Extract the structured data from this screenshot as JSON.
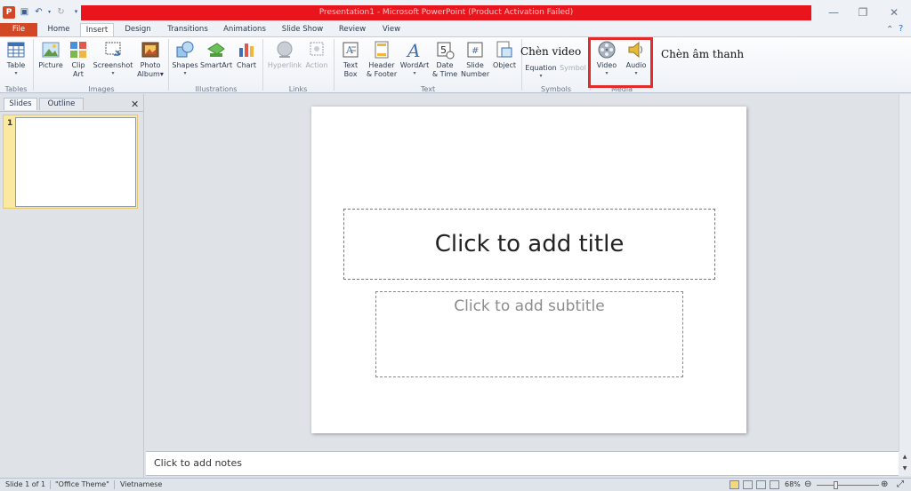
{
  "window": {
    "title": "Presentation1 - Microsoft PowerPoint (Product Activation Failed)",
    "app_icon_letter": "P"
  },
  "tabs": [
    "File",
    "Home",
    "Insert",
    "Design",
    "Transitions",
    "Animations",
    "Slide Show",
    "Review",
    "View"
  ],
  "ribbon": {
    "groups": {
      "tables": "Tables",
      "images": "Images",
      "illustrations": "Illustrations",
      "links": "Links",
      "text": "Text",
      "symbols": "Symbols",
      "media": "Media"
    },
    "buttons": {
      "table": "Table",
      "picture": "Picture",
      "clip_art_1": "Clip",
      "clip_art_2": "Art",
      "screenshot": "Screenshot",
      "photo_album_1": "Photo",
      "photo_album_2": "Album",
      "shapes": "Shapes",
      "smartart": "SmartArt",
      "chart": "Chart",
      "hyperlink": "Hyperlink",
      "action": "Action",
      "text_box_1": "Text",
      "text_box_2": "Box",
      "header_footer_1": "Header",
      "header_footer_2": "& Footer",
      "wordart": "WordArt",
      "date_time_1": "Date",
      "date_time_2": "& Time",
      "slide_number_1": "Slide",
      "slide_number_2": "Number",
      "object": "Object",
      "equation": "Equation",
      "symbol": "Symbol",
      "video": "Video",
      "audio": "Audio"
    }
  },
  "annotations": {
    "video": "Chèn video",
    "audio": "Chèn âm thanh"
  },
  "left_pane": {
    "tab_slides": "Slides",
    "tab_outline": "Outline",
    "slide_number": "1"
  },
  "slide": {
    "title_placeholder": "Click to add title",
    "subtitle_placeholder": "Click to add subtitle"
  },
  "notes": {
    "placeholder": "Click to add notes"
  },
  "status": {
    "slide_info": "Slide 1 of 1",
    "theme": "\"Office Theme\"",
    "language": "Vietnamese",
    "zoom": "68%"
  },
  "colors": {
    "title_bar_red": "#e8151c",
    "file_tab": "#d24726",
    "highlight_box": "#e32b2b"
  }
}
